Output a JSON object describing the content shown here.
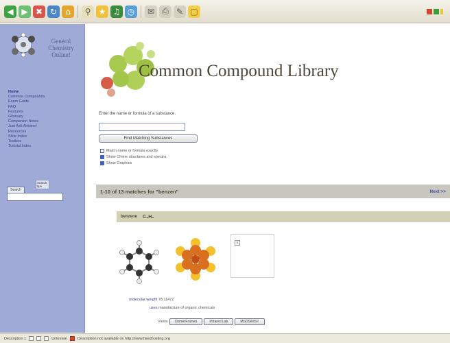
{
  "browser": {
    "toolbar_icons": [
      "back-icon",
      "forward-icon",
      "stop-icon",
      "refresh-icon",
      "home-icon",
      "search-icon",
      "favorites-icon",
      "media-icon",
      "history-icon",
      "mail-icon",
      "print-icon",
      "edit-icon",
      "folder-icon"
    ],
    "status": {
      "left": "Description 1",
      "zone": "Unknown",
      "message": "Description not available on http://www.fixedhosting.org"
    }
  },
  "sidebar": {
    "logo_text": "General Chemistry Online!",
    "nav": [
      "Home",
      "Common Compounds",
      "Exam Guide",
      "FAQ",
      "Features",
      "Glossary",
      "Companion Notes",
      "Just Ask Antoine!",
      "Resources",
      "Slide Index",
      "Toolbox",
      "Tutorial Index"
    ],
    "search_button": "Search",
    "search_help": "Search tips"
  },
  "main": {
    "title": "Common Compound Library",
    "prompt": "Enter the name or formula of a substance.",
    "query_value": "",
    "find_button": "Find Matching Substances",
    "options": [
      {
        "label": "Match name or formula exactly",
        "checked": false
      },
      {
        "label": "Show Chime structures and spectra",
        "checked": true
      },
      {
        "label": "Show Graphics",
        "checked": true
      }
    ],
    "results_text": "1-10 of 13 matches for \"benzen\"",
    "next_link": "Next >>",
    "entry": {
      "name": "benzene",
      "formula": "C₆H₆",
      "molwt_label": "molecular weight",
      "molwt_value": "78.11472",
      "uses_label": "uses",
      "uses_value": "manufacture of organic chemicals",
      "view_label": "Views",
      "view_buttons": [
        "Chime/Frames",
        "Infrared Lab",
        "MSDS/NIST"
      ]
    }
  },
  "colors": {
    "sidebar_bg": "#9faad6",
    "results_bar": "#c8c6be",
    "entry_bar": "#d2d1b4",
    "link": "#3a4590"
  }
}
